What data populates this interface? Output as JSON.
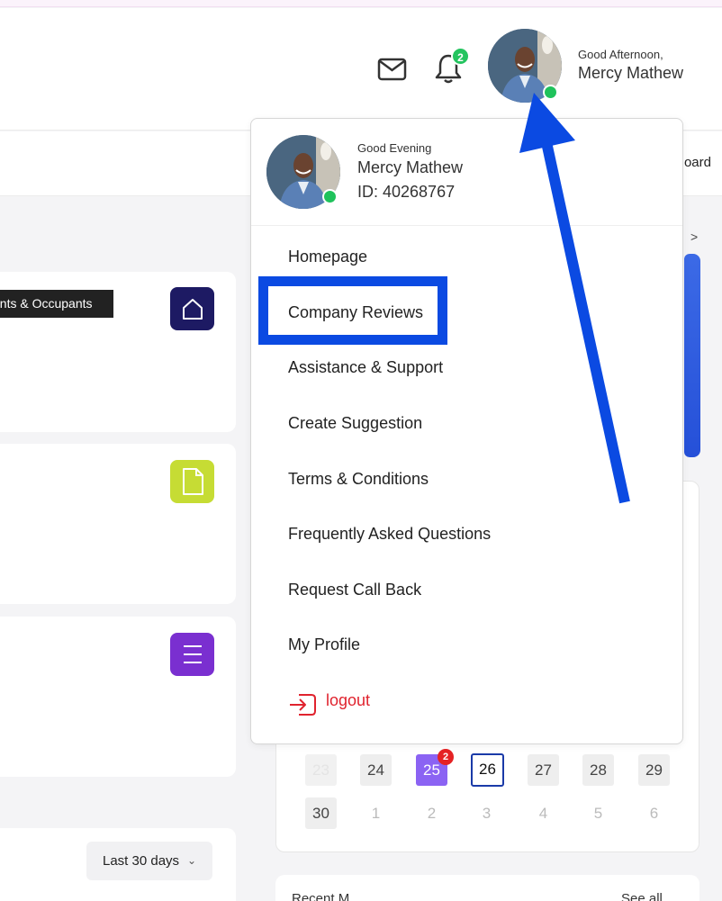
{
  "header": {
    "greeting": "Good Afternoon,",
    "user_name": "Mercy Mathew",
    "notification_count": "2"
  },
  "subnav": {
    "right_label": "oard"
  },
  "tooltip": {
    "text": "ants & Occupants"
  },
  "right_panel": {
    "arrow": ">"
  },
  "dropdown": {
    "greeting": "Good Evening",
    "user_name": "Mercy Mathew",
    "user_id": "ID: 40268767",
    "items": [
      "Homepage",
      "Company Reviews",
      "Assistance & Support",
      "Create Suggestion",
      "Terms & Conditions",
      "Frequently Asked Questions",
      "Request Call Back",
      "My Profile"
    ],
    "logout_label": "logout"
  },
  "calendar": {
    "row1": [
      "23",
      "24",
      "25",
      "26",
      "27",
      "28",
      "29"
    ],
    "row2": [
      "30",
      "1",
      "2",
      "3",
      "4",
      "5",
      "6"
    ],
    "selected_badge": "2"
  },
  "filters": {
    "range_label": "Last 30 days"
  },
  "bottom": {
    "left_text": "Recent M",
    "right_text": "See all"
  },
  "colors": {
    "highlight": "#0b4ae2",
    "logout": "#e0232e",
    "online": "#1fc25b",
    "selected_day": "#8b63f3",
    "tile_home": "#1d1a63",
    "tile_doc": "#c6dc34",
    "tile_list": "#7a2fd0"
  },
  "icons": [
    "mail-icon",
    "bell-icon",
    "home-icon",
    "document-icon",
    "list-icon",
    "logout-icon",
    "chevron-down-icon",
    "chevron-right-icon"
  ]
}
